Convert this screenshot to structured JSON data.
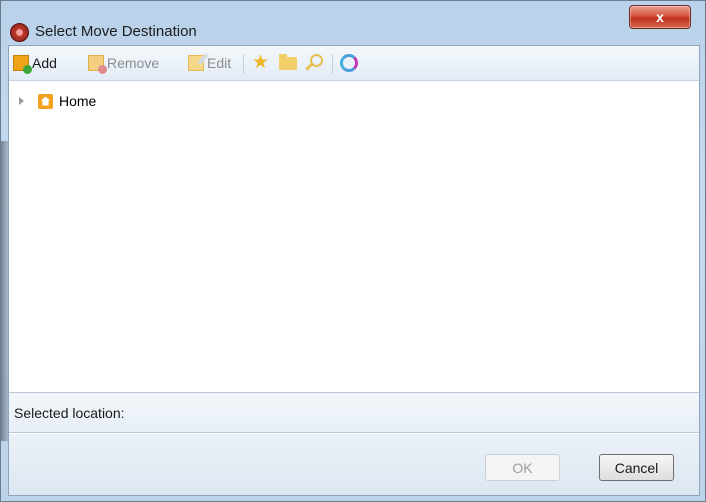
{
  "window": {
    "title": "Select Move Destination",
    "close_label": "x"
  },
  "toolbar": {
    "add_label": "Add",
    "remove_label": "Remove",
    "edit_label": "Edit",
    "icons": [
      "add-icon",
      "remove-icon",
      "edit-icon",
      "star-icon",
      "folder-icon",
      "search-icon",
      "refresh-icon"
    ]
  },
  "tree": {
    "items": [
      {
        "label": "Home",
        "icon": "home-icon",
        "expanded": false
      }
    ]
  },
  "status": {
    "selected_location_label": "Selected location:"
  },
  "buttons": {
    "ok_label": "OK",
    "cancel_label": "Cancel"
  },
  "colors": {
    "title_bar": "#c7dbef",
    "close_button": "#c0301a",
    "toolbar_bg": "#e2ebf5",
    "accent_orange": "#f0a218"
  }
}
